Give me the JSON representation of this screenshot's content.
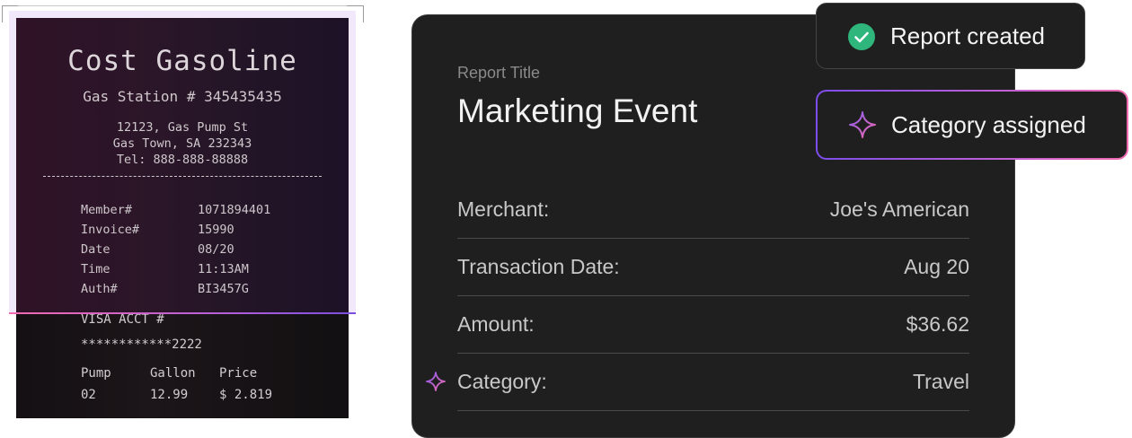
{
  "receipt": {
    "title": "Cost Gasoline",
    "station": "Gas Station # 345435435",
    "address": [
      "12123, Gas Pump St",
      "Gas Town, SA 232343",
      "Tel: 888-888-88888"
    ],
    "fields": [
      {
        "key": "Member#",
        "value": "1071894401"
      },
      {
        "key": "Invoice#",
        "value": "15990"
      },
      {
        "key": "Date",
        "value": "08/20"
      },
      {
        "key": "Time",
        "value": "11:13AM"
      },
      {
        "key": "Auth#",
        "value": "BI3457G"
      }
    ],
    "visa_label": "VISA ACCT #",
    "visa_number": "************2222",
    "pump_headers": [
      "Pump",
      "Gallon",
      "Price"
    ],
    "pump_values": [
      "02",
      "12.99",
      "$ 2.819"
    ]
  },
  "report": {
    "title_label": "Report Title",
    "title": "Marketing Event",
    "rows": [
      {
        "label": "Merchant:",
        "value": "Joe's American"
      },
      {
        "label": "Transaction Date:",
        "value": "Aug 20"
      },
      {
        "label": "Amount:",
        "value": "$36.62"
      },
      {
        "label": "Category:",
        "value": "Travel"
      }
    ]
  },
  "toasts": {
    "created": {
      "label": "Report created",
      "icon": "check-circle-icon",
      "color": "#2fb67c"
    },
    "category": {
      "label": "Category assigned",
      "icon": "sparkle-icon"
    }
  },
  "colors": {
    "accent_pink": "#f06ab0",
    "accent_purple": "#7c4dea",
    "card_bg": "#1f1f1f"
  }
}
